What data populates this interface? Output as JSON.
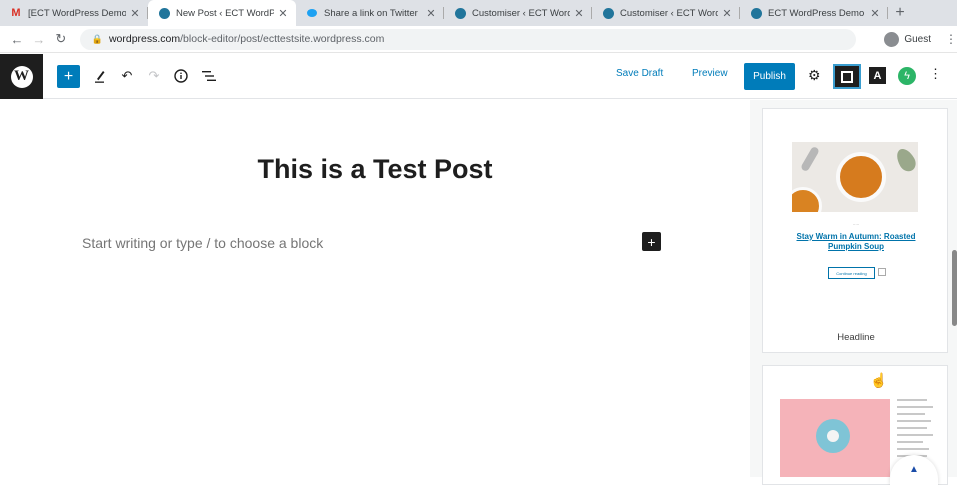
{
  "browser": {
    "tabs": [
      {
        "label": "[ECT WordPress Demo Ti",
        "icon": "gmail-icon",
        "icon_color": "#d93025",
        "active": false
      },
      {
        "label": "New Post ‹ ECT WordPre",
        "icon": "wordpress-icon",
        "icon_color": "#21759b",
        "active": true
      },
      {
        "label": "Share a link on Twitter",
        "icon": "twitter-icon",
        "icon_color": "#1da1f2",
        "active": false
      },
      {
        "label": "Customiser ‹ ECT Word",
        "icon": "wordpress-icon",
        "icon_color": "#21759b",
        "active": false
      },
      {
        "label": "Customiser ‹ ECT Word",
        "icon": "wordpress-icon",
        "icon_color": "#21759b",
        "active": false
      },
      {
        "label": "ECT WordPress Demo Ti",
        "icon": "wordpress-icon",
        "icon_color": "#21759b",
        "active": false
      }
    ],
    "close_glyph": "✕",
    "new_tab_glyph": "+",
    "url_host": "wordpress.com",
    "url_path": "/block-editor/post/ecttestsite.wordpress.com",
    "profile_label": "Guest"
  },
  "toolbar": {
    "inserter_glyph": "+",
    "save_draft": "Save Draft",
    "preview": "Preview",
    "publish": "Publish",
    "plugin_b_label": "A"
  },
  "editor": {
    "title": "This is a Test Post",
    "placeholder": "Start writing or type / to choose a block",
    "add_block_glyph": "+"
  },
  "patterns": {
    "card1": {
      "link_text": "Stay Warm in Autumn: Roasted Pumpkin Soup",
      "button_text": "Continue reading",
      "label": "Headline"
    }
  },
  "colors": {
    "accent": "#007cba",
    "dark": "#1e1e1e",
    "plugin_green": "#2cb567"
  }
}
